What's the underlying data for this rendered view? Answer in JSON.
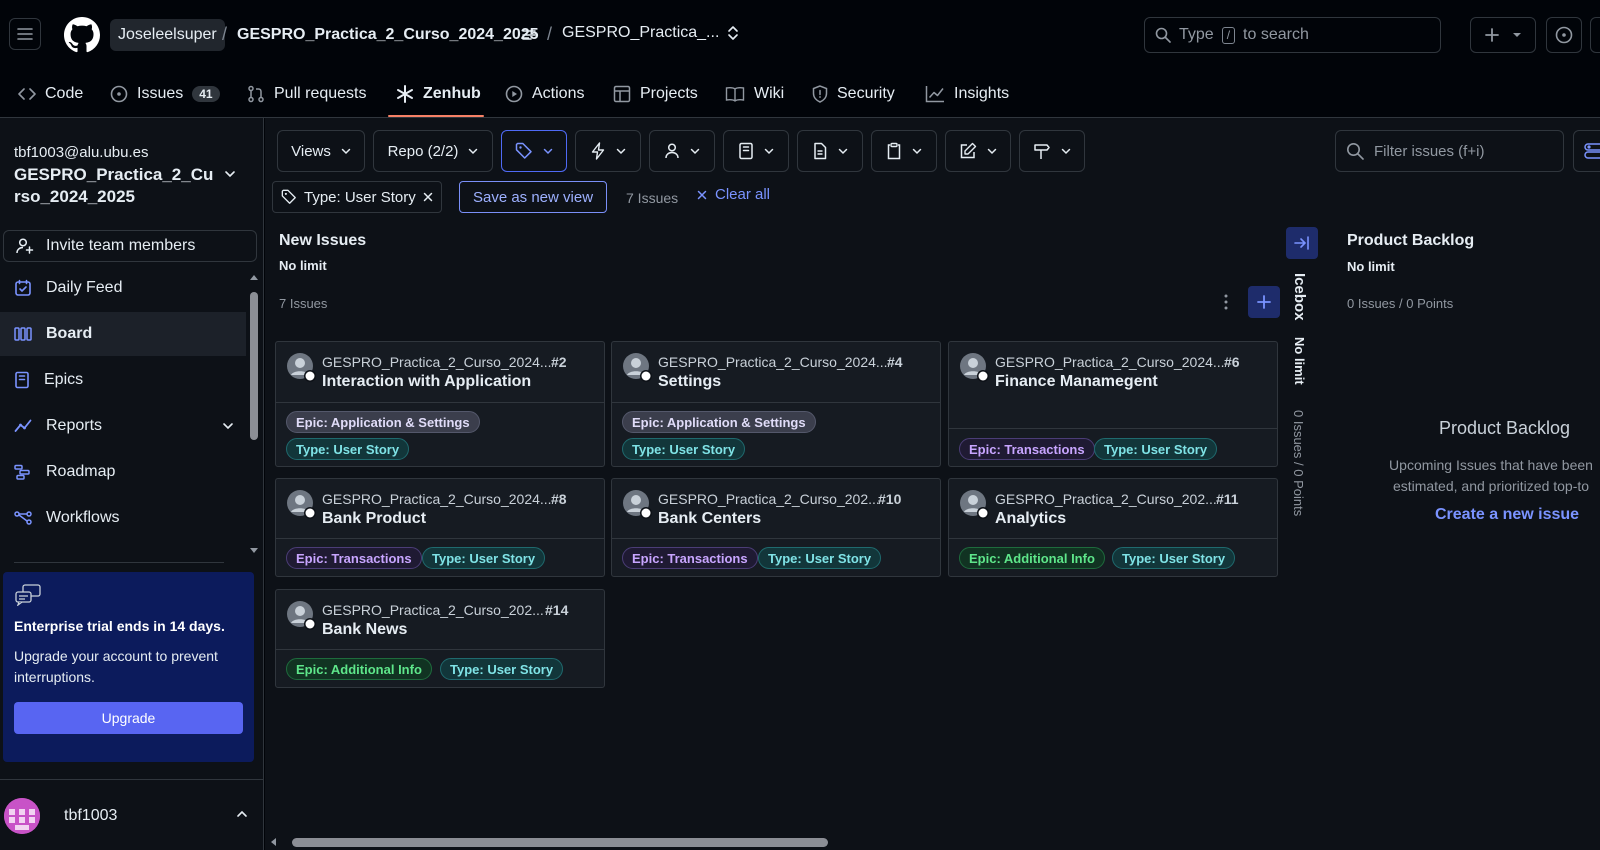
{
  "header": {
    "owner": "Joseleelsuper",
    "slash": "/",
    "repo": "GESPRO_Practica_2_Curso_2024_2025",
    "project": "GESPRO_Practica_...",
    "search_prefix": "Type",
    "search_key": "/",
    "search_suffix": "to search"
  },
  "repo_nav": {
    "tabs": [
      {
        "label": "Code"
      },
      {
        "label": "Issues",
        "count": "41"
      },
      {
        "label": "Pull requests"
      },
      {
        "label": "Zenhub"
      },
      {
        "label": "Actions"
      },
      {
        "label": "Projects"
      },
      {
        "label": "Wiki"
      },
      {
        "label": "Security"
      },
      {
        "label": "Insights"
      }
    ]
  },
  "sidebar": {
    "email": "tbf1003@alu.ubu.es",
    "workspace": "GESPRO_Practica_2_Curso_2024_2025",
    "invite": "Invite team members",
    "items": [
      {
        "label": "Daily Feed"
      },
      {
        "label": "Board"
      },
      {
        "label": "Epics"
      },
      {
        "label": "Reports"
      },
      {
        "label": "Roadmap"
      },
      {
        "label": "Workflows"
      }
    ],
    "trial_title": "Enterprise trial ends in 14 days.",
    "trial_text": "Upgrade your account to prevent interruptions.",
    "upgrade": "Upgrade",
    "user": "tbf1003"
  },
  "toolbar": {
    "views": "Views",
    "repo": "Repo (2/2)",
    "filter_placeholder": "Filter issues (f+i)",
    "chip": "Type: User Story",
    "save_view": "Save as new view",
    "issues_count": "7 Issues",
    "clear_all": "Clear all"
  },
  "board": {
    "new_issues": {
      "title": "New Issues",
      "limit": "No limit",
      "count": "7 Issues"
    },
    "icebox": {
      "title": "Icebox",
      "limit": "No limit",
      "count": "0 Issues / 0 Points"
    },
    "product_backlog": {
      "title": "Product Backlog",
      "limit": "No limit",
      "count": "0 Issues / 0 Points",
      "empty_title": "Product Backlog",
      "empty_line1": "Upcoming Issues that have been",
      "empty_line2": "estimated, and prioritized top-to",
      "create": "Create a new issue"
    },
    "cards": [
      {
        "repo": "GESPRO_Practica_2_Curso_2024...",
        "num": "#2",
        "title": "Interaction with Application",
        "epic": "Epic: Application & Settings",
        "type": "Type: User Story"
      },
      {
        "repo": "GESPRO_Practica_2_Curso_2024...",
        "num": "#4",
        "title": "Settings",
        "epic": "Epic: Application & Settings",
        "type": "Type: User Story"
      },
      {
        "repo": "GESPRO_Practica_2_Curso_2024...",
        "num": "#6",
        "title": "Finance Manamegent",
        "epic": "Epic: Transactions",
        "type": "Type: User Story"
      },
      {
        "repo": "GESPRO_Practica_2_Curso_2024...",
        "num": "#8",
        "title": "Bank Product",
        "epic": "Epic: Transactions",
        "type": "Type: User Story"
      },
      {
        "repo": "GESPRO_Practica_2_Curso_202...",
        "num": "#10",
        "title": "Bank Centers",
        "epic": "Epic: Transactions",
        "type": "Type: User Story"
      },
      {
        "repo": "GESPRO_Practica_2_Curso_202...",
        "num": "#11",
        "title": "Analytics",
        "epic": "Epic: Additional Info",
        "type": "Type: User Story"
      },
      {
        "repo": "GESPRO_Practica_2_Curso_202...",
        "num": "#14",
        "title": "Bank News",
        "epic": "Epic: Additional Info",
        "type": "Type: User Story"
      }
    ]
  }
}
